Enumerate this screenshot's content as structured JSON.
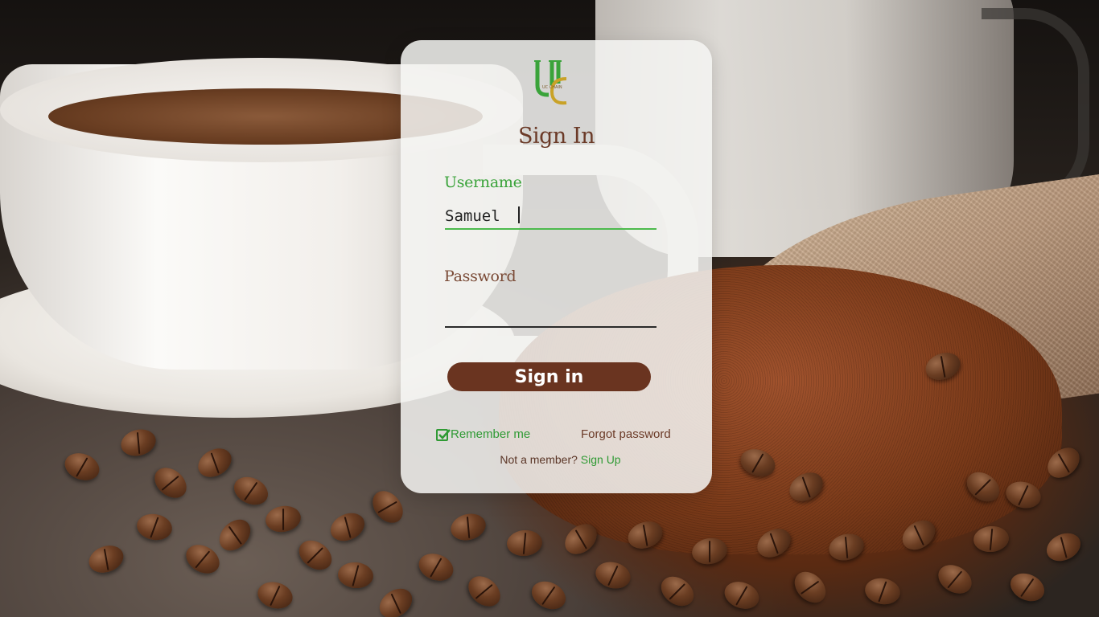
{
  "login": {
    "title": "Sign In",
    "username_label": "Username",
    "username_value": "Samuel",
    "password_label": "Password",
    "password_value": "",
    "sign_in_label": "Sign in",
    "remember_label": "Remember me",
    "remember_checked": true,
    "forgot_label": "Forgot password",
    "member_prompt": "Not a member?",
    "signup_label": "Sign Up"
  },
  "colors": {
    "brand_green": "#3aa33a",
    "brand_brown": "#6a3420",
    "card_bg": "#f5f4f2"
  },
  "icons": {
    "logo": "uc-logo",
    "remember": "checkbox-checked-icon"
  }
}
